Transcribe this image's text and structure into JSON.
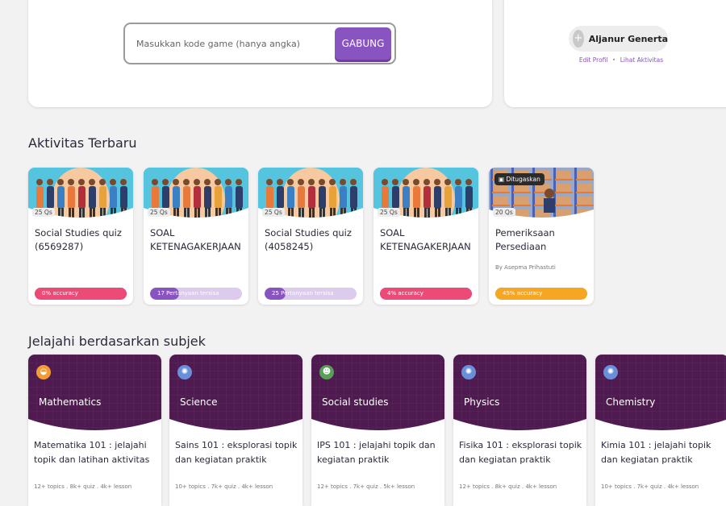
{
  "join": {
    "placeholder": "Masukkan kode game (hanya angka)",
    "button_label": "GABUNG"
  },
  "profile": {
    "avatar_glyph": "+",
    "name": "Aljanur Generta",
    "edit_label": "Edit Profil",
    "separator": "•",
    "activity_label": "Lihat Aktivitas"
  },
  "recent": {
    "title": "Aktivitas Terbaru",
    "cards": [
      {
        "questions": "25 Qs",
        "title": "Social Studies quiz (6569287)",
        "progress_label": "0% accuracy",
        "progress_fraction": 1.0,
        "fill_color": "#ec4b78",
        "track_color": "#ec4b78",
        "thumb": "workers"
      },
      {
        "questions": "25 Qs",
        "title": "SOAL KETENAGAKERJAAN",
        "progress_label": "17 Pertanyaan tersisa",
        "progress_fraction": 0.32,
        "fill_color": "#8854c0",
        "track_color": "#dccbed",
        "thumb": "workers"
      },
      {
        "questions": "25 Qs",
        "title": "Social Studies quiz (4058245)",
        "progress_label": "25 Pertanyaan tersisa",
        "progress_fraction": 0.23,
        "fill_color": "#8854c0",
        "track_color": "#dccbed",
        "thumb": "workers"
      },
      {
        "questions": "25 Qs",
        "title": "SOAL KETENAGAKERJAAN",
        "progress_label": "4% accuracy",
        "progress_fraction": 1.0,
        "fill_color": "#ec4b78",
        "track_color": "#ec4b78",
        "thumb": "workers"
      },
      {
        "questions": "20 Qs",
        "title": "Pemeriksaan Persediaan",
        "author": "By Asepma Prihastuti",
        "assigned_label": "Ditugaskan",
        "progress_label": "45% accuracy",
        "progress_fraction": 1.0,
        "fill_color": "#f5a623",
        "track_color": "#f5a623",
        "thumb": "warehouse"
      }
    ]
  },
  "subjects": {
    "title": "Jelajahi berdasarkan subjek",
    "header_color": "#4f1a4f",
    "cards": [
      {
        "name": "Mathematics",
        "icon": "math-icon",
        "icon_glyph": "◒",
        "icon_color": "#f39c33",
        "description": "Matematika 101 : jelajahi topik dan latihan aktivitas",
        "meta": "12+ topics . 8k+ quiz . 4k+ lesson"
      },
      {
        "name": "Science",
        "icon": "science-icon",
        "icon_glyph": "✺",
        "icon_color": "#6a8fd8",
        "description": "Sains 101 : eksplorasi topik dan kegiatan praktik",
        "meta": "10+ topics . 7k+ quiz . 4k+ lesson"
      },
      {
        "name": "Social studies",
        "icon": "social-studies-icon",
        "icon_glyph": "☻",
        "icon_color": "#58a05a",
        "description": "IPS 101 : jelajahi topik dan kegiatan praktik",
        "meta": "12+ topics . 7k+ quiz . 5k+ lesson"
      },
      {
        "name": "Physics",
        "icon": "physics-icon",
        "icon_glyph": "✺",
        "icon_color": "#6a8fd8",
        "description": "Fisika 101 : eksplorasi topik dan kegiatan praktik",
        "meta": "12+ topics . 8k+ quiz . 4k+ lesson"
      },
      {
        "name": "Chemistry",
        "icon": "chemistry-icon",
        "icon_glyph": "✺",
        "icon_color": "#6a8fd8",
        "description": "Kimia 101 : jelajahi topik dan kegiatan praktik",
        "meta": "10+ topics . 7k+ quiz . 4k+ lesson"
      }
    ]
  }
}
